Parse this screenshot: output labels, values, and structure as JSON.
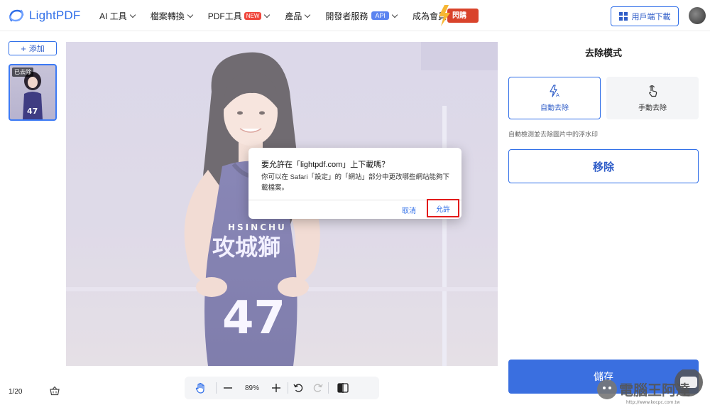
{
  "brand": {
    "name": "LightPDF",
    "accent": "#2f6ee8"
  },
  "nav": {
    "ai_tools": "AI 工具",
    "convert": "檔案轉換",
    "pdf_tools": "PDF工具",
    "pdf_tools_badge": "NEW",
    "products": "產品",
    "developer": "開發者服務",
    "developer_badge": "API",
    "membership": "成為會員",
    "flash_sale": "閃購"
  },
  "header_right": {
    "download_label": "用戶端下載"
  },
  "sidebar": {
    "add_label": "添加",
    "thumb_tag": "已去除",
    "page_count": "1/20"
  },
  "toolbar": {
    "zoom": "89%"
  },
  "panel": {
    "title": "去除模式",
    "auto_label": "自動去除",
    "manual_label": "手動去除",
    "description": "自動檢測並去除圖片中的浮水印",
    "remove_label": "移除",
    "save_label": "儲存"
  },
  "dialog": {
    "title": "要允許在「lightpdf.com」上下載嗎？",
    "body": "你可以在 Safari「設定」的「網站」部分中更改哪些網站能夠下載檔案。",
    "cancel_label": "取消",
    "allow_label": "允許"
  },
  "photo": {
    "jersey_text": "HSINCHU",
    "jersey_team": "攻城獅",
    "jersey_number": "47"
  },
  "watermark": {
    "text": "電腦王阿達",
    "url": "http://www.kocpc.com.tw"
  }
}
